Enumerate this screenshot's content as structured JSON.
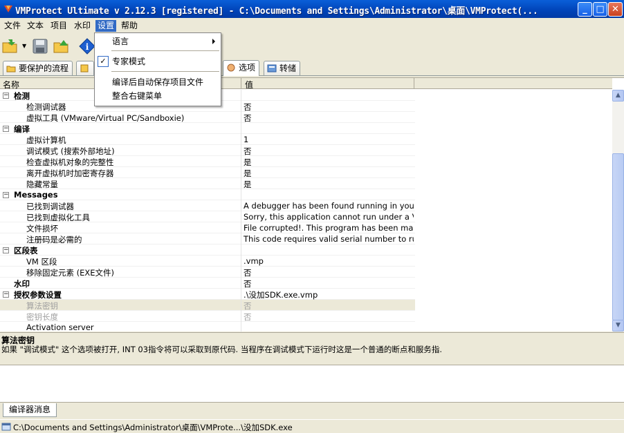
{
  "window": {
    "title": "VMProtect Ultimate v 2.12.3 [registered] - C:\\Documents and Settings\\Administrator\\桌面\\VMProtect(...",
    "min_glyph": "_",
    "max_glyph": "□",
    "close_glyph": "✕"
  },
  "menubar": {
    "items": [
      "文件",
      "文本",
      "项目",
      "水印",
      "设置",
      "帮助"
    ]
  },
  "dropdown": {
    "items": [
      {
        "label": "语言",
        "has_submenu": true
      },
      {
        "label": "专家模式",
        "checked": true
      },
      {
        "label": "编译后自动保存项目文件"
      },
      {
        "label": "整合右键菜单"
      }
    ],
    "check_glyph": "✓"
  },
  "tabs": {
    "items": [
      "要保护的流程",
      "选项",
      "转储"
    ]
  },
  "grid": {
    "headers": {
      "name": "名称",
      "value": "值"
    },
    "collapse_glyph": "−",
    "rows": [
      {
        "type": "cat",
        "name": "检测",
        "value": ""
      },
      {
        "type": "item",
        "name": "检测调试器",
        "value": "否"
      },
      {
        "type": "item",
        "name": "虚拟工具 (VMware/Virtual PC/Sandboxie)",
        "value": "否"
      },
      {
        "type": "cat",
        "name": "编译",
        "value": ""
      },
      {
        "type": "item",
        "name": "虚拟计算机",
        "value": "1"
      },
      {
        "type": "item",
        "name": "调试模式 (搜索外部地址)",
        "value": "否"
      },
      {
        "type": "item",
        "name": "检查虚拟机对象的完整性",
        "value": "是"
      },
      {
        "type": "item",
        "name": "离开虚拟机时加密寄存器",
        "value": "是"
      },
      {
        "type": "item",
        "name": "隐藏常量",
        "value": "是"
      },
      {
        "type": "cat",
        "name": "Messages",
        "value": ""
      },
      {
        "type": "item",
        "name": "已找到调试器",
        "value": "A debugger has been found running in your syst..."
      },
      {
        "type": "item",
        "name": "已找到虚拟化工具",
        "value": "Sorry, this application cannot run under a Virtual..."
      },
      {
        "type": "item",
        "name": "文件损坏",
        "value": "File corrupted!. This program has been manipula..."
      },
      {
        "type": "item",
        "name": "注册码是必需的",
        "value": "This code requires valid serial number to run.Pro..."
      },
      {
        "type": "cat",
        "name": "区段表",
        "value": ""
      },
      {
        "type": "item",
        "name": "VM 区段",
        "value": ".vmp"
      },
      {
        "type": "item",
        "name": "移除固定元素 (EXE文件)",
        "value": "否"
      },
      {
        "type": "catnobox",
        "name": "水印",
        "value": "否"
      },
      {
        "type": "cat",
        "name": "授权参数设置",
        "value": ".\\没加SDK.exe.vmp"
      },
      {
        "type": "item-sel",
        "name": "算法密钥",
        "value": "否"
      },
      {
        "type": "item-gray",
        "name": "密钥长度",
        "value": "否"
      },
      {
        "type": "item",
        "name": "Activation server",
        "value": ""
      }
    ]
  },
  "description": {
    "title": "算法密钥",
    "body": "如果 \"调试模式\" 这个选项被打开, INT 03指令将可以采取到原代码. 当程序在调试模式下运行时这是一个普通的断点和服务指."
  },
  "bottom_tab": "编译器消息",
  "status": "C:\\Documents and Settings\\Administrator\\桌面\\VMProte...\\没加SDK.exe",
  "colors": {
    "titlebar": "#0a5fd8",
    "selection": "#316ac5",
    "chrome": "#ece9d8"
  }
}
